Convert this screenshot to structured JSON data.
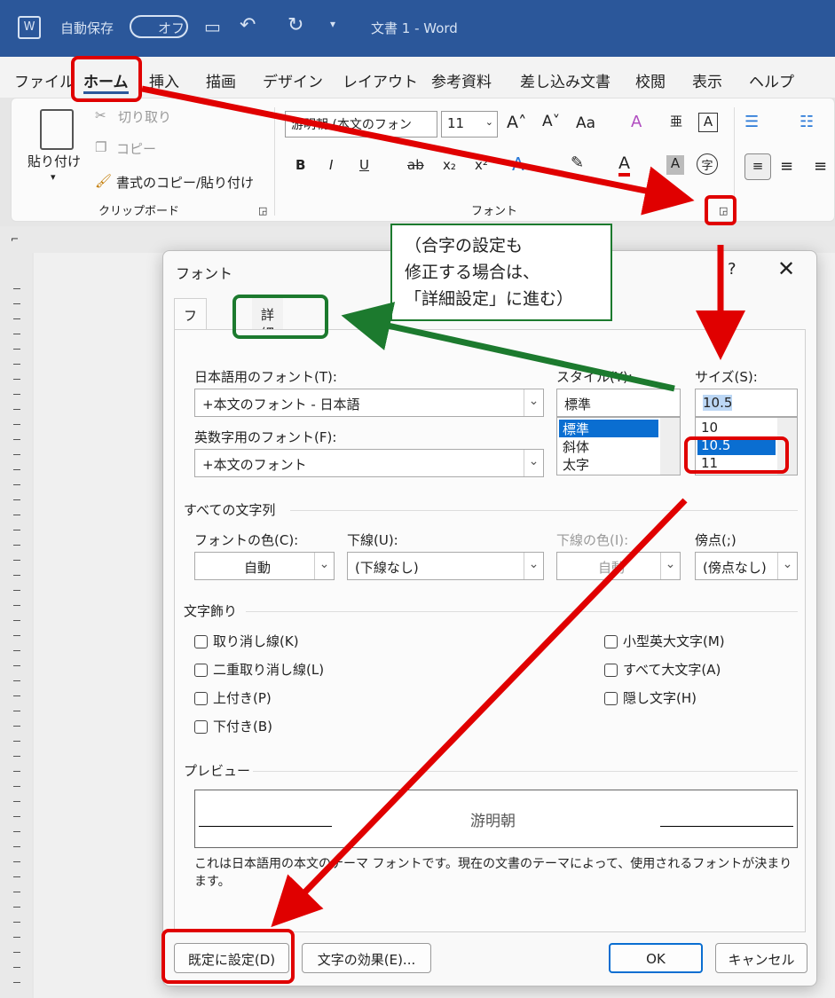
{
  "titlebar": {
    "autosave_label": "自動保存",
    "autosave_toggle": "オフ",
    "doc_title": "文書 1  -  Word"
  },
  "menu": {
    "items": [
      "ファイル",
      "ホーム",
      "挿入",
      "描画",
      "デザイン",
      "レイアウト",
      "参考資料",
      "差し込み文書",
      "校閲",
      "表示",
      "ヘルプ"
    ]
  },
  "ribbon": {
    "paste": "貼り付け",
    "cut": "切り取り",
    "copy": "コピー",
    "format_painter": "書式のコピー/貼り付け",
    "clipboard_group": "クリップボード",
    "font_name": "游明朝 (本文のフォン",
    "font_size": "11",
    "font_group": "フォント",
    "bold": "B",
    "italic": "I",
    "underline": "U",
    "strike": "ab",
    "subscript": "x₂",
    "superscript": "x²",
    "font_color": "A",
    "char_shade": "A",
    "aa": "Aa"
  },
  "dialog": {
    "title": "フォント",
    "help": "?",
    "close": "✕",
    "tabs": [
      "フォント",
      "詳細設定"
    ],
    "jp_font_label": "日本語用のフォント(T):",
    "jp_font_value": "+本文のフォント - 日本語",
    "en_font_label": "英数字用のフォント(F):",
    "en_font_value": "+本文のフォント",
    "style_label": "スタイル(Y):",
    "style_value": "標準",
    "style_items": [
      "標準",
      "斜体",
      "太字"
    ],
    "size_label": "サイズ(S):",
    "size_value": "10.5",
    "size_items": [
      "10",
      "10.5",
      "11"
    ],
    "all_text_section": "すべての文字列",
    "font_color_label": "フォントの色(C):",
    "font_color_value": "自動",
    "underline_label": "下線(U):",
    "underline_value": "(下線なし)",
    "underline_color_label": "下線の色(I):",
    "underline_color_value": "自動",
    "emphasis_label": "傍点(;)",
    "emphasis_value": "(傍点なし)",
    "effects_section": "文字飾り",
    "effects_left": [
      "取り消し線(K)",
      "二重取り消し線(L)",
      "上付き(P)",
      "下付き(B)"
    ],
    "effects_right": [
      "小型英大文字(M)",
      "すべて大文字(A)",
      "隠し文字(H)"
    ],
    "preview_section": "プレビュー",
    "preview_text": "游明朝",
    "description": "これは日本語用の本文のテーマ フォントです。現在の文書のテーマによって、使用されるフォントが決まります。",
    "set_default_button": "既定に設定(D)",
    "text_effects_button": "文字の効果(E)...",
    "ok_button": "OK",
    "cancel_button": "キャンセル"
  },
  "callout": {
    "lines": [
      "（合字の設定も",
      "修正する場合は、",
      "「詳細設定」に進む）"
    ]
  },
  "colors": {
    "title_bar": "#2b579a",
    "annotation_red": "#e00000",
    "annotation_green": "#1c7a2e",
    "selection_blue": "#0a6ed1"
  }
}
